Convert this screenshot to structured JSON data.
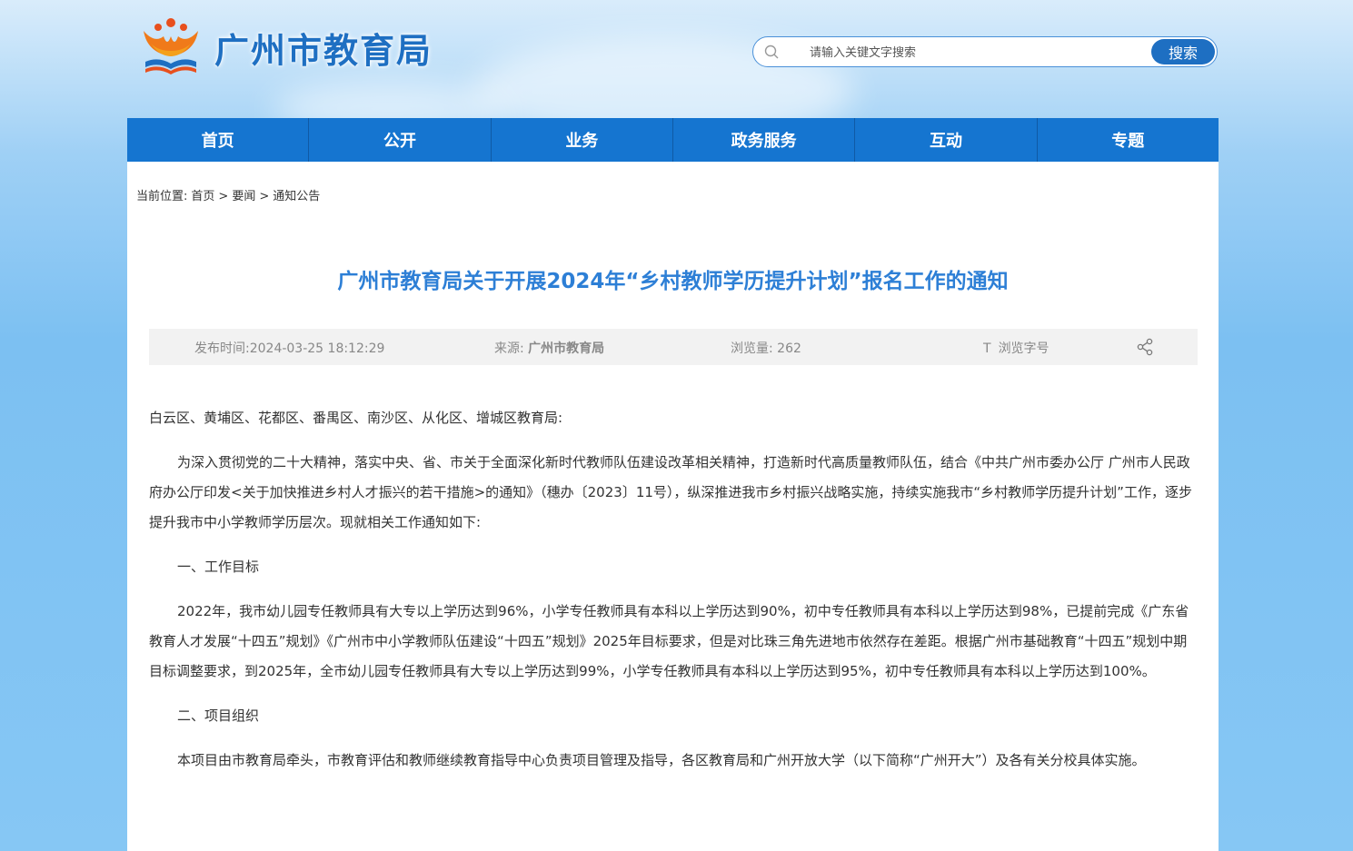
{
  "header": {
    "site_title": "广州市教育局",
    "search_placeholder": "请输入关键文字搜索",
    "search_button": "搜索"
  },
  "nav": {
    "items": [
      "首页",
      "公开",
      "业务",
      "政务服务",
      "互动",
      "专题"
    ]
  },
  "breadcrumb": {
    "prefix": "当前位置:",
    "items": [
      "首页",
      "要闻",
      "通知公告"
    ],
    "separator": ">"
  },
  "article": {
    "title": "广州市教育局关于开展2024年“乡村教师学历提升计划”报名工作的通知",
    "meta": {
      "publish_label": "发布时间:",
      "publish_time": "2024-03-25 18:12:29",
      "source_label": "来源:",
      "source": "广州市教育局",
      "views_label": "浏览量:",
      "views": "262",
      "font_label": "浏览字号"
    },
    "paragraphs": [
      "白云区、黄埔区、花都区、番禺区、南沙区、从化区、增城区教育局:",
      "为深入贯彻党的二十大精神，落实中央、省、市关于全面深化新时代教师队伍建设改革相关精神，打造新时代高质量教师队伍，结合《中共广州市委办公厅 广州市人民政府办公厅印发<关于加快推进乡村人才振兴的若干措施>的通知》（穗办〔2023〕11号），纵深推进我市乡村振兴战略实施，持续实施我市“乡村教师学历提升计划”工作，逐步提升我市中小学教师学历层次。现就相关工作通知如下:",
      "一、工作目标",
      "2022年，我市幼儿园专任教师具有大专以上学历达到96%，小学专任教师具有本科以上学历达到90%，初中专任教师具有本科以上学历达到98%，已提前完成《广东省教育人才发展“十四五”规划》《广州市中小学教师队伍建设“十四五”规划》2025年目标要求，但是对比珠三角先进地市依然存在差距。根据广州市基础教育“十四五”规划中期目标调整要求，到2025年，全市幼儿园专任教师具有大专以上学历达到99%，小学专任教师具有本科以上学历达到95%，初中专任教师具有本科以上学历达到100%。",
      "二、项目组织",
      "本项目由市教育局牵头，市教育评估和教师继续教育指导中心负责项目管理及指导，各区教育局和广州开放大学（以下简称“广州开大”）及各有关分校具体实施。"
    ]
  },
  "colors": {
    "nav_bg": "#1575d0",
    "title": "#2d7fd6",
    "brand": "#1e6fc2"
  },
  "icons": [
    "emblem-logo-icon",
    "search-icon",
    "font-size-icon",
    "share-icon"
  ]
}
